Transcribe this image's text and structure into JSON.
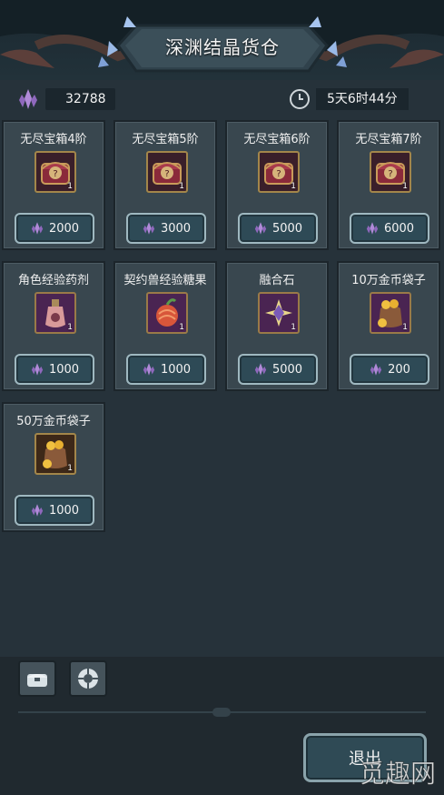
{
  "header": {
    "title": "深渊结晶货仓"
  },
  "topbar": {
    "currency": "32788",
    "timer": "5天6时44分"
  },
  "items": [
    {
      "name": "无尽宝箱4阶",
      "qty": "1",
      "price": "2000",
      "icon": "treasure-chest-icon"
    },
    {
      "name": "无尽宝箱5阶",
      "qty": "1",
      "price": "3000",
      "icon": "treasure-chest-icon"
    },
    {
      "name": "无尽宝箱6阶",
      "qty": "1",
      "price": "5000",
      "icon": "treasure-chest-icon"
    },
    {
      "name": "无尽宝箱7阶",
      "qty": "1",
      "price": "6000",
      "icon": "treasure-chest-icon"
    },
    {
      "name": "角色经验药剂",
      "qty": "1",
      "price": "1000",
      "icon": "potion-icon"
    },
    {
      "name": "契约兽经验糖果",
      "qty": "1",
      "price": "1000",
      "icon": "candy-icon"
    },
    {
      "name": "融合石",
      "qty": "1",
      "price": "5000",
      "icon": "fusion-stone-icon"
    },
    {
      "name": "10万金币袋子",
      "qty": "1",
      "price": "200",
      "icon": "gold-bag-icon"
    },
    {
      "name": "50万金币袋子",
      "qty": "1",
      "price": "1000",
      "icon": "gold-bag-icon"
    }
  ],
  "bottom": {
    "exit_label": "退出"
  },
  "watermark": {
    "text": "觅趣网"
  },
  "colors": {
    "crystal": "#b08ad8",
    "card_bg": "#39474f",
    "price_bg": "#2e4a56"
  }
}
